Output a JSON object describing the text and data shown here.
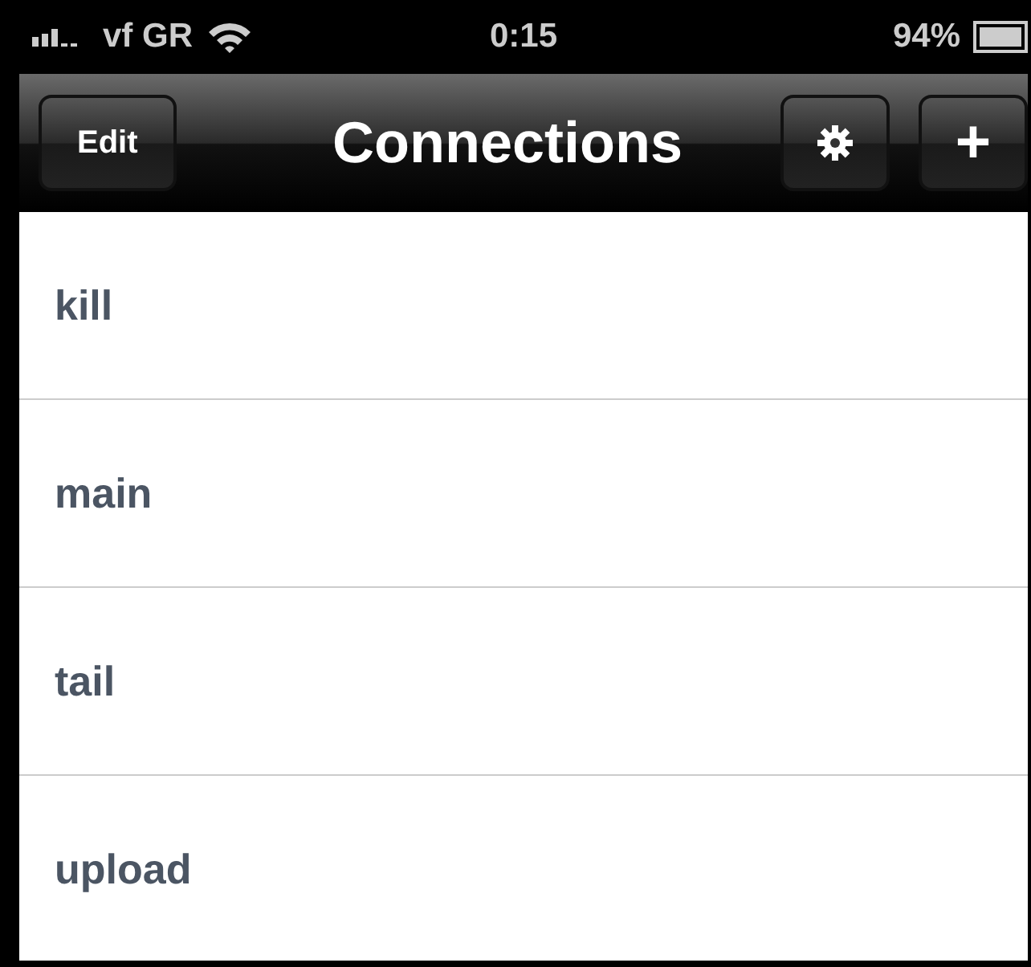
{
  "status_bar": {
    "carrier": "vf GR",
    "time": "0:15",
    "battery": "94%"
  },
  "nav_bar": {
    "title": "Connections",
    "edit_button": "Edit",
    "add_button": "+"
  },
  "connections": [
    {
      "name": "kill"
    },
    {
      "name": "main"
    },
    {
      "name": "tail"
    },
    {
      "name": "upload"
    }
  ]
}
